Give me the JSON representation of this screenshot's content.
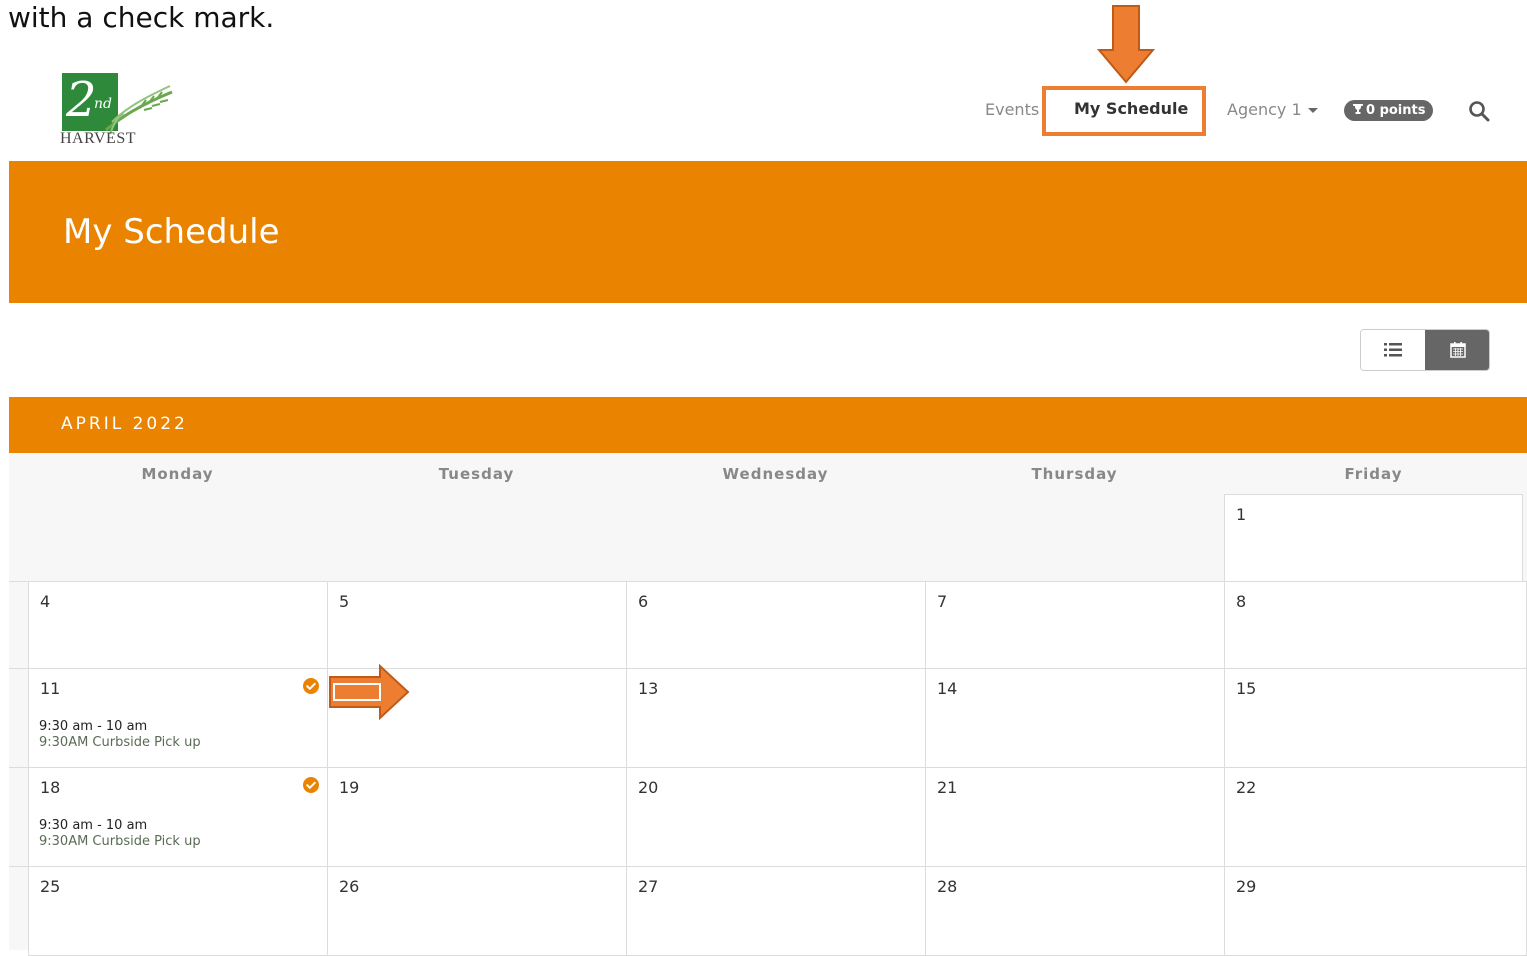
{
  "caption": "with a check mark.",
  "logo": {
    "two": "2",
    "nd": "nd",
    "harvest": "HARVEST"
  },
  "nav": {
    "events": "Events",
    "my_schedule": "My Schedule",
    "agency": "Agency 1",
    "points": "0 points"
  },
  "page_title": "My Schedule",
  "month_label": "APRIL 2022",
  "weekdays": [
    "Monday",
    "Tuesday",
    "Wednesday",
    "Thursday",
    "Friday"
  ],
  "calendar": {
    "week1": {
      "fri": "1"
    },
    "week2": {
      "mon": "4",
      "tue": "5",
      "wed": "6",
      "thu": "7",
      "fri": "8"
    },
    "week3": {
      "mon": "11",
      "tue": "",
      "wed": "13",
      "thu": "14",
      "fri": "15"
    },
    "week4": {
      "mon": "18",
      "tue": "19",
      "wed": "20",
      "thu": "21",
      "fri": "22"
    },
    "week5": {
      "mon": "25",
      "tue": "26",
      "wed": "27",
      "thu": "28",
      "fri": "29"
    }
  },
  "events": {
    "apr11": {
      "time": "9:30 am - 10 am",
      "name": "9:30AM Curbside Pick up"
    },
    "apr18": {
      "time": "9:30 am - 10 am",
      "name": "9:30AM Curbside Pick up"
    }
  },
  "colors": {
    "brand_orange": "#E98300",
    "annotation_orange": "#ED7D31",
    "logo_green": "#2e8a3a"
  }
}
